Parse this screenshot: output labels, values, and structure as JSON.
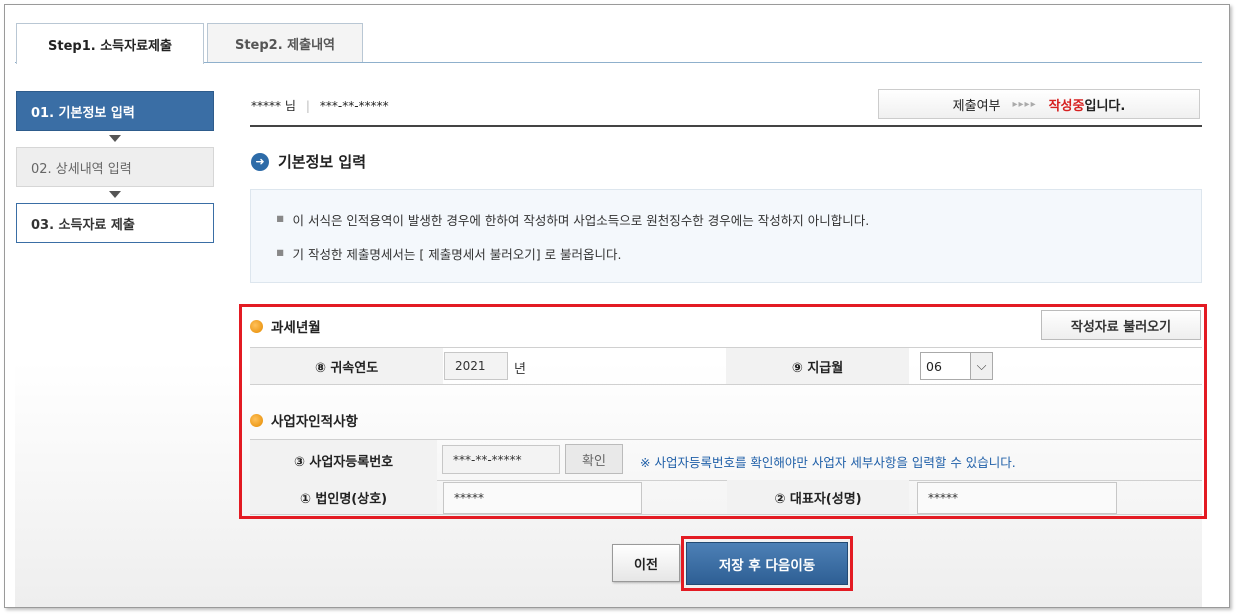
{
  "tabs": [
    {
      "label": "Step1. 소득자료제출",
      "active": true
    },
    {
      "label": "Step2. 제출내역",
      "active": false
    }
  ],
  "steps": [
    {
      "label": "01. 기본정보 입력"
    },
    {
      "label": "02. 상세내역 입력"
    },
    {
      "label": "03. 소득자료 제출"
    }
  ],
  "header": {
    "user_name": "***** 님",
    "user_id": "***-**-*****",
    "status_label": "제출여부",
    "status_arrows": "▸▸▸▸",
    "status_value": "작성중",
    "status_suffix": "입니다."
  },
  "section": {
    "title": "기본정보 입력",
    "notices": [
      "이 서식은 인적용역이 발생한 경우에 한하여 작성하며 사업소득으로 원천징수한 경우에는 작성하지 아니합니다.",
      "기 작성한 제출명세서는 [ 제출명세서 불러오기] 로 불러옵니다."
    ]
  },
  "form": {
    "group1_label": "과세년월",
    "load_button": "작성자료 불러오기",
    "year_label": "⑧ 귀속연도",
    "year_value": "2021",
    "year_unit": "년",
    "month_label": "⑨ 지급월",
    "month_value": "06",
    "group2_label": "사업자인적사항",
    "bizno_label": "③ 사업자등록번호",
    "bizno_value": "***-**-*****",
    "confirm_button": "확인",
    "bizno_note": "※ 사업자등록번호를 확인해야만 사업자 세부사항을 입력할 수 있습니다.",
    "corp_label": "① 법인명(상호)",
    "corp_value": "*****",
    "rep_label": "② 대표자(성명)",
    "rep_value": "*****"
  },
  "buttons": {
    "prev": "이전",
    "next": "저장 후 다음이동"
  },
  "colors": {
    "accent_blue": "#3a6ea5",
    "highlight_red": "#e31b23",
    "status_red": "#d62020"
  }
}
